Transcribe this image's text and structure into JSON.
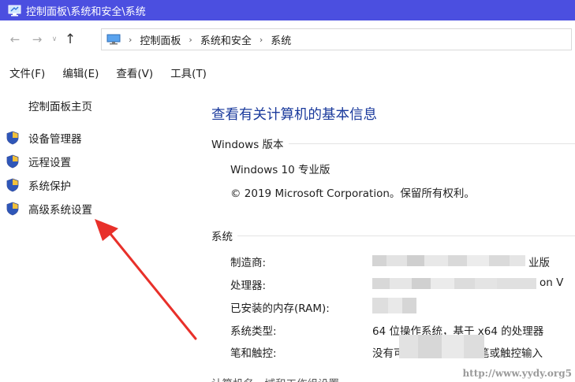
{
  "window": {
    "title": "控制面板\\系统和安全\\系统"
  },
  "address": {
    "breadcrumb": [
      "控制面板",
      "系统和安全",
      "系统"
    ],
    "separator": "›",
    "nav": {
      "back": "←",
      "forward": "→",
      "dropdown": "∨",
      "up": "↑"
    }
  },
  "menu": [
    "文件(F)",
    "编辑(E)",
    "查看(V)",
    "工具(T)"
  ],
  "sidebar": {
    "home": "控制面板主页",
    "tasks": [
      "设备管理器",
      "远程设置",
      "系统保护",
      "高级系统设置"
    ]
  },
  "main": {
    "heading": "查看有关计算机的基本信息",
    "windows_edition": {
      "section": "Windows 版本",
      "edition": "Windows 10 专业版",
      "copyright": "© 2019 Microsoft Corporation。保留所有权利。"
    },
    "system": {
      "section": "系统",
      "rows": [
        {
          "label": "制造商:",
          "value": "业版"
        },
        {
          "label": "处理器:",
          "value": "on V"
        },
        {
          "label": "已安装的内存(RAM):",
          "value": ""
        },
        {
          "label": "系统类型:",
          "value": "64 位操作系统，基于 x64 的处理器"
        },
        {
          "label": "笔和触控:",
          "value": "没有可用于此显示器的笔或触控输入"
        }
      ]
    },
    "next_section_partial": "计算机名、域和工作组设置"
  },
  "watermark": "http://www.yydy.org5",
  "colors": {
    "titlebar": "#4b4fe0",
    "heading": "#1a3a9c",
    "arrow": "#e8302a"
  }
}
